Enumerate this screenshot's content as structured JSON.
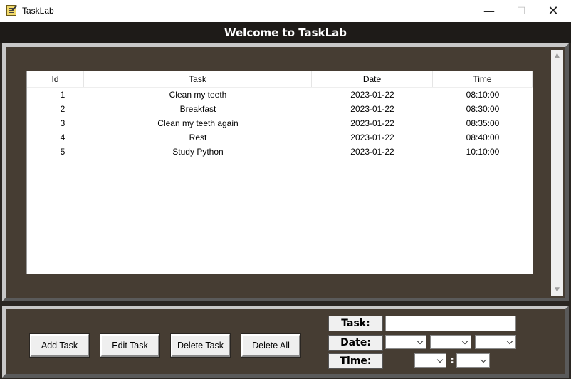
{
  "window": {
    "title": "TaskLab",
    "minimize_glyph": "—",
    "maximize_glyph": "☐",
    "close_glyph": "✕"
  },
  "header": {
    "title": "Welcome to TaskLab"
  },
  "table": {
    "columns": [
      "Id",
      "Task",
      "Date",
      "Time"
    ],
    "rows": [
      {
        "id": "1",
        "task": "Clean my teeth",
        "date": "2023-01-22",
        "time": "08:10:00"
      },
      {
        "id": "2",
        "task": "Breakfast",
        "date": "2023-01-22",
        "time": "08:30:00"
      },
      {
        "id": "3",
        "task": "Clean my teeth again",
        "date": "2023-01-22",
        "time": "08:35:00"
      },
      {
        "id": "4",
        "task": "Rest",
        "date": "2023-01-22",
        "time": "08:40:00"
      },
      {
        "id": "5",
        "task": "Study Python",
        "date": "2023-01-22",
        "time": "10:10:00"
      }
    ]
  },
  "buttons": {
    "add": "Add Task",
    "edit": "Edit Task",
    "delete": "Delete Task",
    "delete_all": "Delete All"
  },
  "form": {
    "task_label": "Task:",
    "date_label": "Date:",
    "time_label": "Time:",
    "task_value": "",
    "time_separator": ":"
  },
  "colors": {
    "background": "#2a2622",
    "panel": "#463d33",
    "header": "#1e1b18"
  }
}
